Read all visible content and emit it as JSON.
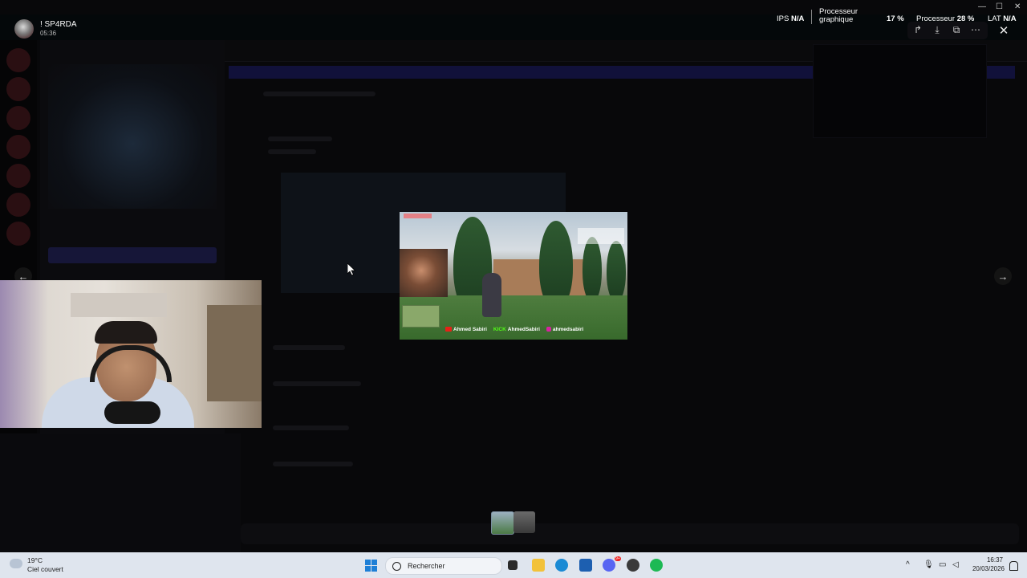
{
  "user": {
    "name": "! SP4RDA",
    "time": "05:36"
  },
  "perf": {
    "ips_label": "IPS",
    "ips_value": "N/A",
    "gpu_label_1": "Processeur",
    "gpu_label_2": "graphique",
    "gpu_value": "17 %",
    "cpu_label": "Processeur",
    "cpu_value": "28 %",
    "lat_label": "LAT",
    "lat_value": "N/A"
  },
  "toolbar": {
    "share_icon": "share-icon",
    "download_icon": "download-icon",
    "open_icon": "open-external-icon",
    "more_icon": "more-icon",
    "close_icon": "close-icon"
  },
  "preview": {
    "social": {
      "youtube": "Ahmed Sabiri",
      "kick_label": "KICK",
      "kick": "AhmedSabiri",
      "instagram": "ahmedsabiri"
    }
  },
  "taskbar": {
    "weather_temp": "19°C",
    "weather_desc": "Ciel couvert",
    "search_placeholder": "Rechercher",
    "clock_time": "16:37",
    "clock_date": "20/03/2026",
    "discord_badge": "9+"
  },
  "colors": {
    "accent": "#5865f2",
    "taskbar_bg": "#dfe5ee",
    "backdrop": "#08080a"
  }
}
